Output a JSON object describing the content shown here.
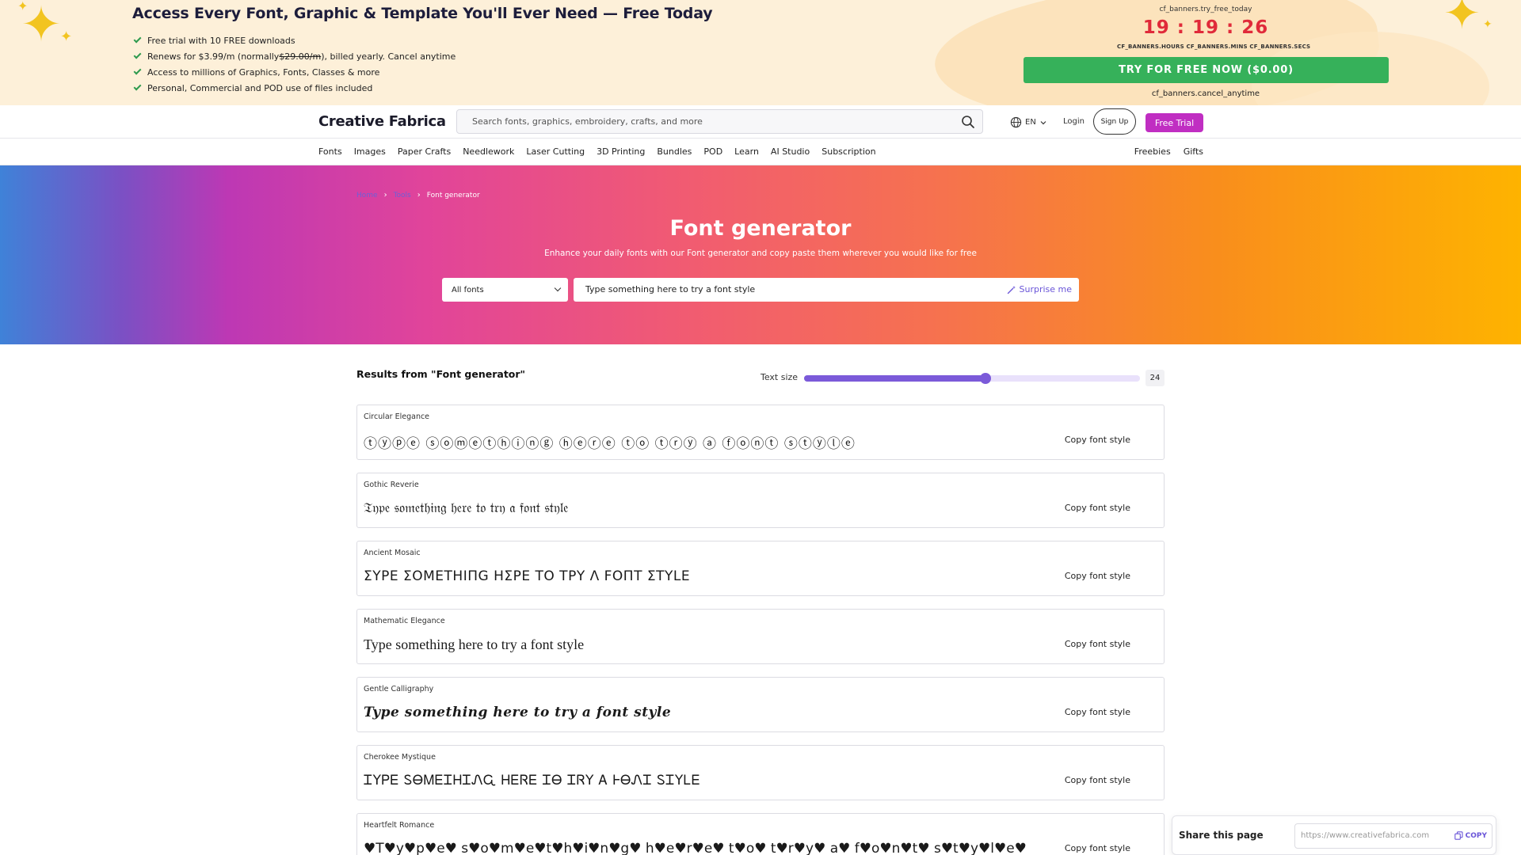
{
  "promo": {
    "title": "Access Every Font, Graphic & Template You'll Ever Need — Free Today",
    "benefits": [
      {
        "text": "Free trial with 10 FREE downloads"
      },
      {
        "pre": "Renews for $3.99/m (normally ",
        "strike": "$29.00/m",
        "post": "), billed yearly. Cancel anytime"
      },
      {
        "text": "Access to millions of Graphics, Fonts, Classes & more"
      },
      {
        "text": "Personal, Commercial and POD use of files included"
      }
    ],
    "countdown_label": "cf_banners.try_free_today",
    "countdown": "19 : 19 : 26",
    "countdown_units": "CF_BANNERS.HOURS CF_BANNERS.MINS CF_BANNERS.SECS",
    "cta": "TRY FOR FREE NOW ($0.00)",
    "cancel_note": "cf_banners.cancel_anytime"
  },
  "header": {
    "logo": "Creative Fabrica",
    "search_placeholder": "Search fonts, graphics, embroidery, crafts, and more",
    "lang": "EN",
    "login": "Login",
    "signup": "Sign Up",
    "free_trial": "Free Trial"
  },
  "nav": {
    "left": [
      "Fonts",
      "Images",
      "Paper Crafts",
      "Needlework",
      "Laser Cutting",
      "3D Printing",
      "Bundles",
      "POD",
      "Learn",
      "AI Studio",
      "Subscription"
    ],
    "right": [
      "Freebies",
      "Gifts"
    ]
  },
  "hero": {
    "breadcrumb": [
      "Home",
      "Tools",
      "Font generator"
    ],
    "title": "Font generator",
    "subtitle": "Enhance your daily fonts with our Font generator and copy paste them wherever you would like for free",
    "select_value": "All fonts",
    "input_value": "Type something here to try a font style",
    "surprise": "Surprise me"
  },
  "results": {
    "title": "Results from \"Font generator\"",
    "text_size_label": "Text size",
    "text_size": 24,
    "text_size_fraction": 0.54,
    "copy_label": "Copy font style",
    "styles": [
      {
        "name": "Circular Elegance",
        "sample": "ⓣⓨⓟⓔ ⓢⓞⓜⓔⓣⓗⓘⓝⓖ ⓗⓔⓡⓔ ⓣⓞ ⓣⓡⓨ ⓐ ⓕⓞⓝⓣ ⓢⓣⓨⓛⓔ",
        "cls": "s-circled"
      },
      {
        "name": "Gothic Reverie",
        "sample": "𝔗𝔶𝔭𝔢 𝔰𝔬𝔪𝔢𝔱𝔥𝔦𝔫𝔤 𝔥𝔢𝔯𝔢 𝔱𝔬 𝔱𝔯𝔶 𝔞 𝔣𝔬𝔫𝔱 𝔰𝔱𝔶𝔩𝔢",
        "cls": "s-gothic"
      },
      {
        "name": "Ancient Mosaic",
        "sample": "ΣYΡΕ ΣΟΜΕΤΗIΠG ΗΣΡΕ ΤΟ ΤΡY Λ FΟΠΤ ΣΤYLΕ",
        "cls": "s-mosaic"
      },
      {
        "name": "Mathematic Elegance",
        "sample": "Type something here to try a font style",
        "cls": "s-math"
      },
      {
        "name": "Gentle Calligraphy",
        "sample": "Type something here to try a font style",
        "cls": "s-script"
      },
      {
        "name": "Cherokee Mystique",
        "sample": "ᏆYᏢᎬ ᏚᎾᎷᎬᏆᎻᏆᏁᏩ ᎻᎬᏒᎬ ᏆᎾ ᏆᏒY Ꭺ ᎰᎾᏁᏆ ᏚᏆYᏞᎬ",
        "cls": "s-cherokee"
      },
      {
        "name": "Heartfelt Romance",
        "sample": "♥T♥y♥p♥e♥ s♥o♥m♥e♥t♥h♥i♥n♥g♥ h♥e♥r♥e♥ t♥o♥ t♥r♥y♥ a♥ f♥o♥n♥t♥ s♥t♥y♥l♥e♥",
        "cls": "s-hearts"
      }
    ]
  },
  "share": {
    "title": "Share this page",
    "url": "https://www.creativefabrica.com",
    "copy": "COPY"
  },
  "colors": {
    "accent_purple": "#c02ec2",
    "cta_green": "#36b15a",
    "countdown_red": "#e02a3a",
    "slider": "#7b5ad9"
  }
}
